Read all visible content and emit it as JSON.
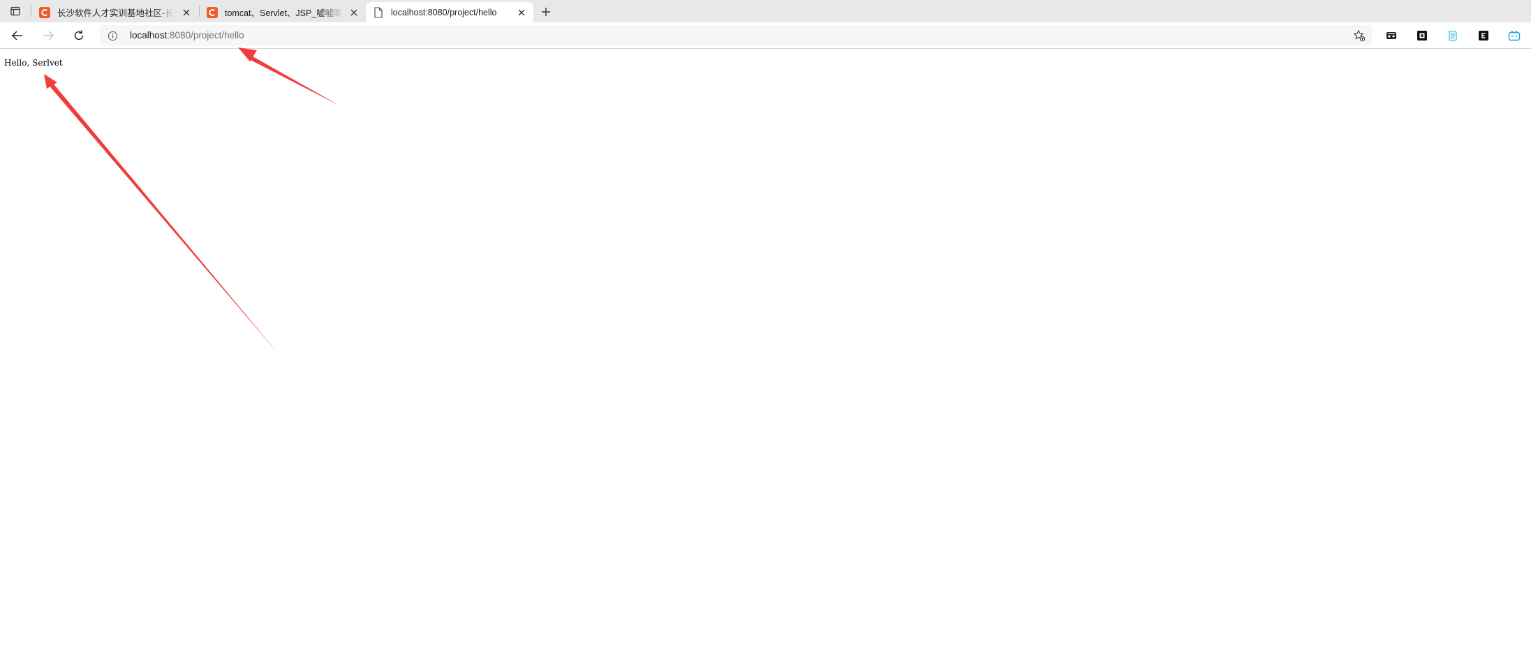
{
  "browser": {
    "tabs": [
      {
        "title": "长沙软件人才实训基地社区-长沙",
        "favicon": "csdn-c-icon",
        "active": false
      },
      {
        "title": "tomcat、Servlet、JSP_嘘嘘嘶-CS",
        "favicon": "csdn-c-icon",
        "active": false
      },
      {
        "title": "localhost:8080/project/hello",
        "favicon": "page-icon",
        "active": true
      }
    ],
    "address": {
      "host": "localhost",
      "rest": ":8080/project/hello"
    },
    "colors": {
      "csdn_red": "#f25a29",
      "annotation_red": "#f03c3c"
    }
  },
  "page": {
    "text": "Hello, Serlvet"
  }
}
